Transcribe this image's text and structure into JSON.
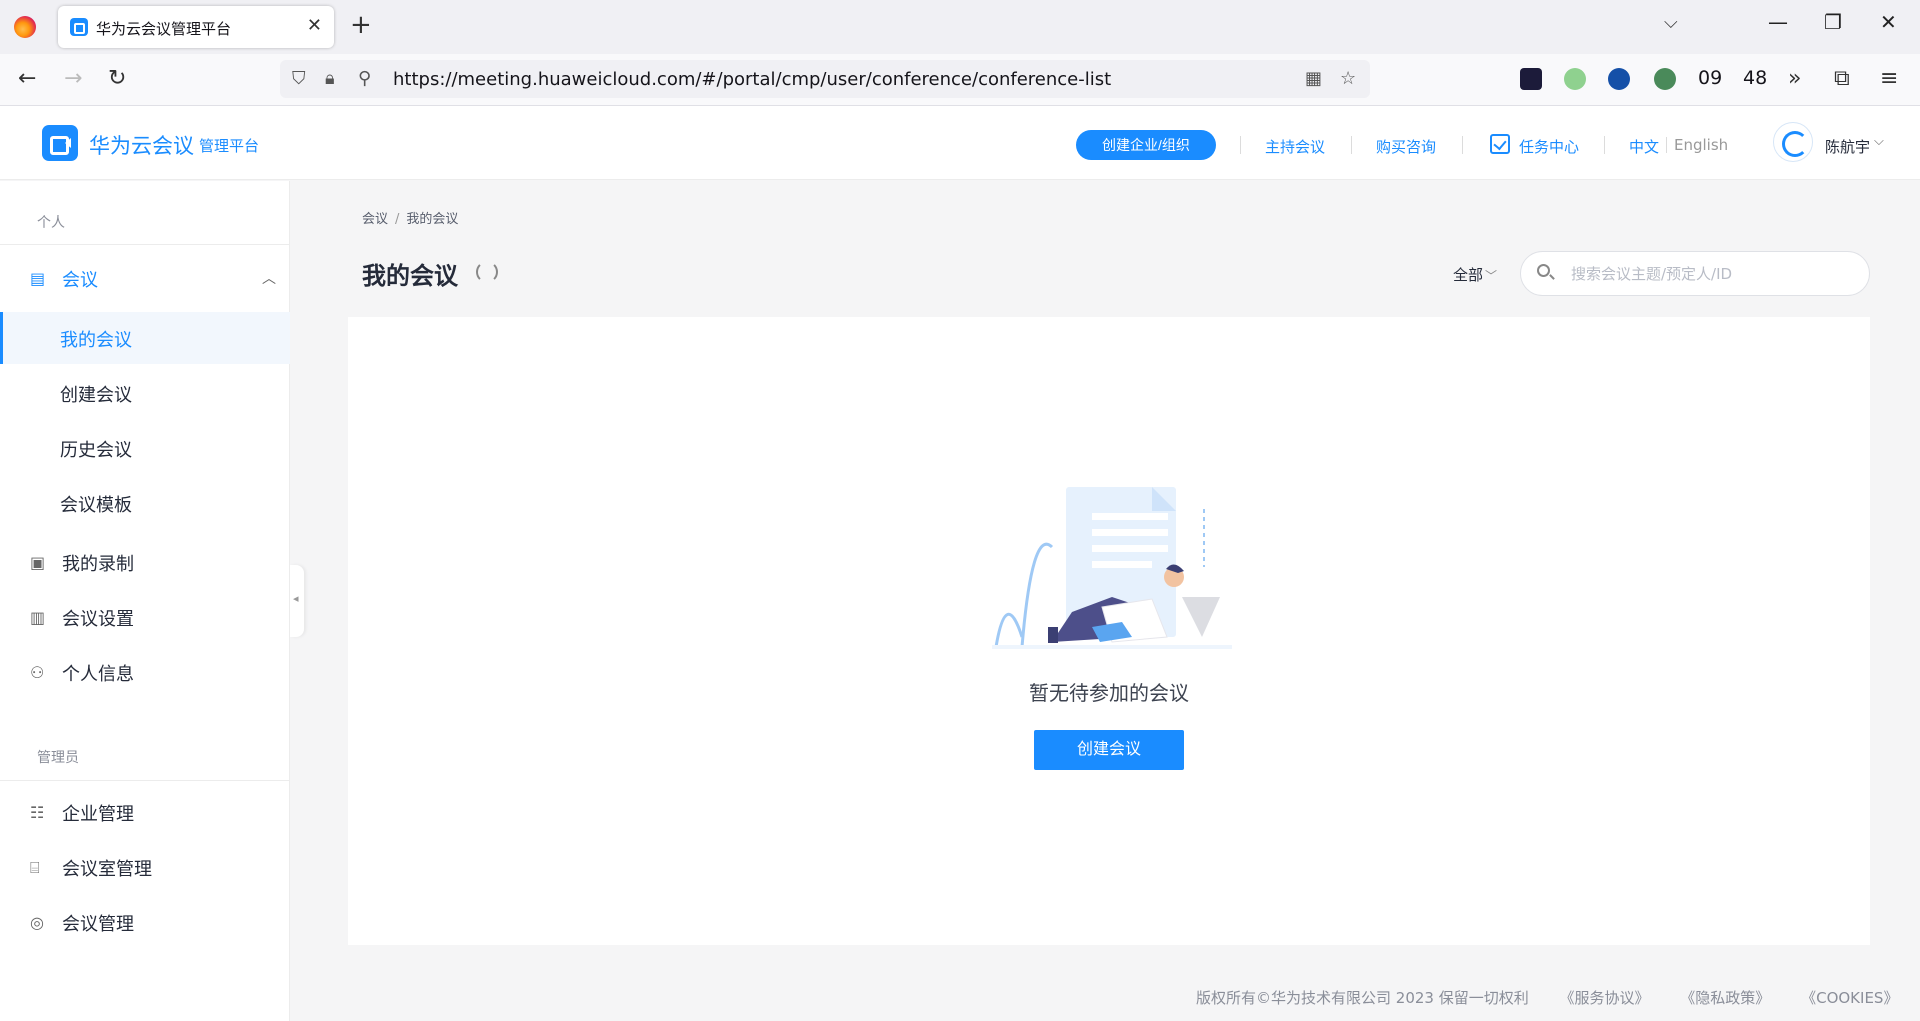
{
  "browser": {
    "tab_title": "华为云会议管理平台",
    "url": "https://meeting.huaweicloud.com/#/portal/cmp/user/conference/conference-list",
    "ext_num_1": "09",
    "ext_num_2": "48"
  },
  "header": {
    "brand_name": "华为云会议",
    "brand_sub": "管理平台",
    "create_org": "创建企业/组织",
    "host_meeting": "主持会议",
    "purchase": "购买咨询",
    "task_center": "任务中心",
    "lang_zh": "中文",
    "lang_en": "English",
    "user_name": "陈航宇"
  },
  "sidebar": {
    "section_personal": "个人",
    "meeting": "会议",
    "sub_items": [
      "我的会议",
      "创建会议",
      "历史会议",
      "会议模板"
    ],
    "my_recording": "我的录制",
    "meeting_settings": "会议设置",
    "personal_info": "个人信息",
    "section_admin": "管理员",
    "enterprise_mgmt": "企业管理",
    "room_mgmt": "会议室管理",
    "meeting_mgmt": "会议管理"
  },
  "main": {
    "breadcrumb_root": "会议",
    "breadcrumb_current": "我的会议",
    "title": "我的会议",
    "filter": "全部",
    "search_placeholder": "搜索会议主题/预定人/ID",
    "empty_text": "暂无待参加的会议",
    "create_button": "创建会议"
  },
  "footer": {
    "copyright": "版权所有©华为技术有限公司 2023 保留一切权利",
    "service": "《服务协议》",
    "privacy": "《隐私政策》",
    "cookies": "《COOKIES》"
  },
  "colors": {
    "accent": "#1a8cff",
    "text": "#252b3a",
    "muted": "#8a8e99"
  }
}
